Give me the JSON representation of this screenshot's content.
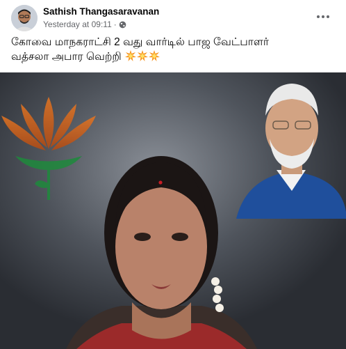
{
  "post": {
    "author": "Sathish Thangasaravanan",
    "timestamp": "Yesterday at 09:11",
    "separator": "·",
    "audience_icon": "globe-icon",
    "more_icon": "more-options-icon",
    "text_line1": "கோவை மாநகராட்சி 2 வது வார்டில் பாஜ வேட்பாளர்",
    "text_line2": "வத்சலா அபார வெற்றி",
    "emojis": [
      "collision-emoji",
      "collision-emoji",
      "collision-emoji"
    ]
  },
  "photo": {
    "subjects": [
      "bjp-lotus-logo",
      "politician-portrait-top-right",
      "woman-candidate-portrait"
    ]
  },
  "colors": {
    "author_text": "#050505",
    "meta_text": "#65676b",
    "photo_bg": "#4d525a",
    "lotus_orange": "#e87722",
    "lotus_green": "#1e8a3c",
    "vest_blue": "#1f4f9c"
  }
}
